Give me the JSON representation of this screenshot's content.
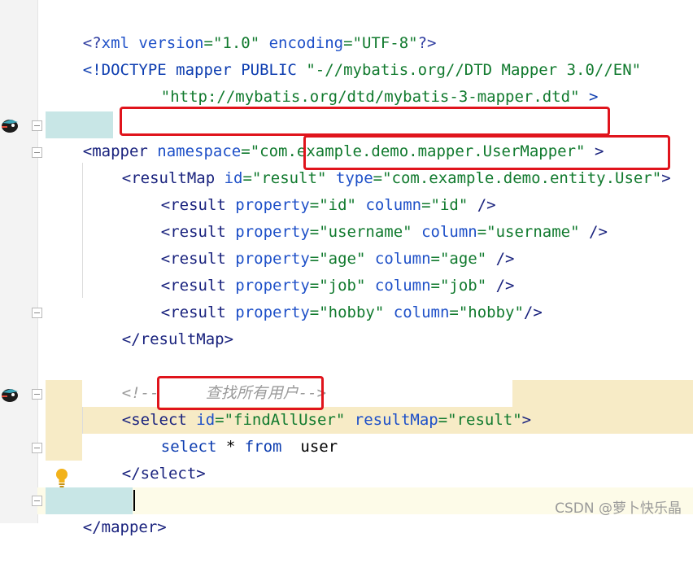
{
  "lines": {
    "l1": {
      "a": "<?",
      "b": "xml version",
      "c": "=\"1.0\"",
      "d": " encoding",
      "e": "=\"UTF-8\"",
      "f": "?>"
    },
    "l2": {
      "a": "<!DOCTYPE mapper PUBLIC ",
      "b": "\"-//mybatis.org//DTD Mapper 3.0//EN\""
    },
    "l3": {
      "a": "\"http://mybatis.org/dtd/mybatis-3-mapper.dtd\"",
      "b": " >"
    },
    "l5": {
      "a": "<",
      "b": "mapper",
      "c": " namespace",
      "d": "=\"com.example.demo.mapper.UserMapper\"",
      "e": " >"
    },
    "l6": {
      "a": "<resultMap",
      "b": " id",
      "c": "=\"result\"",
      "d": " type",
      "e": "=\"com.example.demo.entity.User\"",
      "f": ">"
    },
    "l7": {
      "a": "<result",
      "b": " property",
      "c": "=\"id\"",
      "d": " column",
      "e": "=\"id\"",
      "f": " />"
    },
    "l8": {
      "a": "<result",
      "b": " property",
      "c": "=\"username\"",
      "d": " column",
      "e": "=\"username\"",
      "f": " />"
    },
    "l9": {
      "a": "<result",
      "b": " property",
      "c": "=\"age\"",
      "d": " column",
      "e": "=\"age\"",
      "f": " />"
    },
    "l10": {
      "a": "<result",
      "b": " property",
      "c": "=\"job\"",
      "d": " column",
      "e": "=\"job\"",
      "f": " />"
    },
    "l11": {
      "a": "<result",
      "b": " property",
      "c": "=\"hobby\"",
      "d": " column",
      "e": "=\"hobby\"",
      "f": "/>"
    },
    "l12": {
      "a": "</resultMap>"
    },
    "l14": {
      "a": "<!--     查找所有用户-->"
    },
    "l15": {
      "a": "<select",
      "b": " id",
      "c": "=\"findAllUser\"",
      "d": " resultMap",
      "e": "=\"result\"",
      "f": ">"
    },
    "l16": {
      "a": "select",
      "b": " * ",
      "c": "from",
      "d": "  user"
    },
    "l17": {
      "a": "</select>"
    },
    "l19": {
      "a": "</",
      "b": "mapper",
      "c": ">"
    }
  },
  "watermark": "CSDN @萝卜快乐晶",
  "icons": [
    "mybatis-bird-icon",
    "lightbulb-icon",
    "fold-marker-icon"
  ],
  "colors": {
    "highlight": "#f7ebc6",
    "annotation_border": "#e0141c",
    "string": "#117a2e",
    "attribute": "#1e50c8"
  }
}
